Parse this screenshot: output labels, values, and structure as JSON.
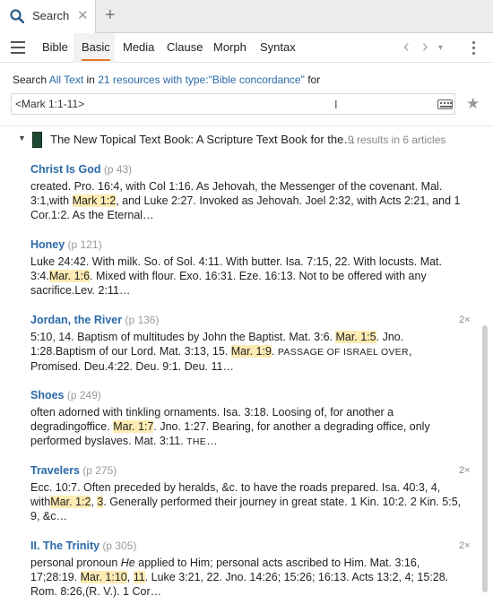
{
  "tab": {
    "title": "Search",
    "close_label": "✕",
    "new_tab_label": "+"
  },
  "toolbar": {
    "modes": [
      "Bible",
      "Basic",
      "Media",
      "Clause",
      "Morph",
      "Syntax"
    ],
    "active_mode": "Basic",
    "back_label": "‹",
    "forward_label": "›",
    "history_label": "▾"
  },
  "scope": {
    "prefix": "Search",
    "text_link": "All Text",
    "in_word": "in",
    "resources_link": "21 resources with type:\"Bible concordance\"",
    "suffix": "for"
  },
  "query": {
    "value": "<Mark 1:1-11>",
    "cursor": "I"
  },
  "book": {
    "caret": "▼",
    "title": "The New Topical Text Book: A Scripture Text Book for the…",
    "count": "9 results in 6 articles"
  },
  "articles": [
    {
      "title": "Christ Is God",
      "page": "(p 43)",
      "mult": "",
      "text": [
        "created. Pro. 16:4, with Col 1:16. As Jehovah, the Messenger of the covenant. Mal. 3:1,",
        "with ",
        {
          "hl": "Mark 1:2"
        },
        ", and Luke 2:27. Invoked as Jehovah. Joel 2:32, with Acts 2:21, and 1 Cor.",
        "1:2. As the Eternal…"
      ]
    },
    {
      "title": "Honey",
      "page": "(p 121)",
      "mult": "",
      "text": [
        "Luke 24:42. With milk. So. of Sol. 4:11. With butter. Isa. 7:15, 22. With locusts. Mat. 3:4.",
        {
          "hl": "Mar. 1:6"
        },
        ". Mixed with flour. Exo. 16:31. Eze. 16:13. Not to be offered with any sacrifice.",
        "Lev. 2:11…"
      ]
    },
    {
      "title": "Jordan, the River",
      "page": "(p 136)",
      "mult": "2×",
      "text": [
        "5:10, 14. Baptism of multitudes by John the Baptist. Mat. 3:6. ",
        {
          "hl": "Mar. 1:5"
        },
        ". Jno. 1:28.",
        "Baptism of our Lord. Mat. 3:13, 15. ",
        {
          "hl": "Mar. 1:9"
        },
        ". ",
        {
          "sc": "PASSAGE OF ISRAEL OVER"
        },
        ", Promised. Deu.",
        "4:22. Deu. 9:1. Deu. 11…"
      ]
    },
    {
      "title": "Shoes",
      "page": "(p 249)",
      "mult": "",
      "text": [
        "often adorned with tinkling ornaments. Isa. 3:18. Loosing of, for another a degrading",
        "office. ",
        {
          "hl": "Mar. 1:7"
        },
        ". Jno. 1:27. Bearing, for another a degrading office, only performed by",
        "slaves. Mat. 3:11. ",
        {
          "sc": "THE"
        },
        "…"
      ]
    },
    {
      "title": "Travelers",
      "page": "(p 275)",
      "mult": "2×",
      "text": [
        "Ecc. 10:7. Often preceded by heralds, &c. to have the roads prepared. Isa. 40:3, 4, with",
        {
          "hl": "Mar. 1:2"
        },
        ", ",
        {
          "hl": "3"
        },
        ". Generally performed their journey in great state. 1 Kin. 10:2. 2 Kin. 5:5, 9, &c",
        "…"
      ]
    },
    {
      "title": "II. The Trinity",
      "page": "(p 305)",
      "mult": "2×",
      "text": [
        "personal pronoun ",
        {
          "i": "He"
        },
        " applied to Him; personal acts ascribed to Him. Mat. 3:16, 17;",
        "28:19. ",
        {
          "hl": "Mar. 1:10"
        },
        ", ",
        {
          "hl": "11"
        },
        ". Luke 3:21, 22. Jno. 14:26; 15:26; 16:13. Acts 13:2, 4; 15:28. Rom. 8:26,",
        "(R. V.). 1 Cor…"
      ]
    }
  ],
  "icons": {
    "search": "search-icon",
    "hamburger": "hamburger-menu-icon",
    "keyboard": "keyboard-icon",
    "star": "star-icon",
    "kebab": "more-options-icon"
  },
  "colors": {
    "link": "#2a6aa8",
    "highlight": "#fdebb3",
    "accent": "#e8742e"
  }
}
